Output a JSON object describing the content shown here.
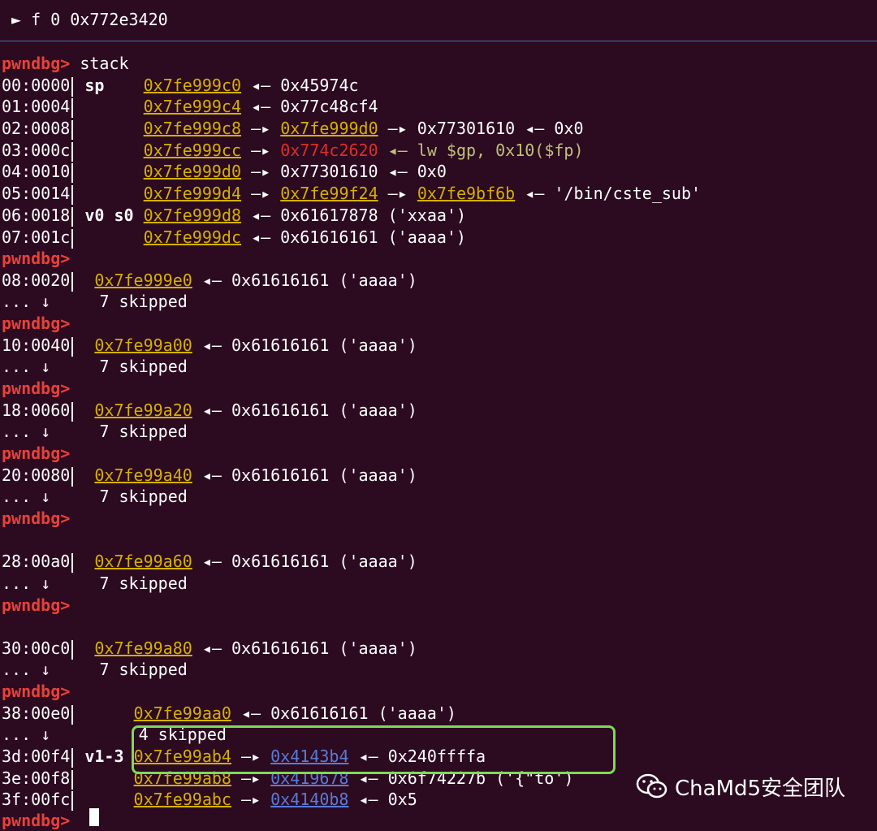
{
  "frame": {
    "marker": "►",
    "text": "f 0 0x772e3420"
  },
  "prompt": "pwndbg>",
  "command": "stack",
  "lines": [
    {
      "idx": "00:0000",
      "reg": "sp",
      "addr": "0x7fe999c0",
      "rest": "◂— 0x45974c"
    },
    {
      "idx": "01:0004",
      "reg": "",
      "addr": "0x7fe999c4",
      "rest": "◂— 0x77c48cf4"
    },
    {
      "idx": "02:0008",
      "reg": "",
      "addr": "0x7fe999c8",
      "arrow": "—▸",
      "addr2": "0x7fe999d0",
      "rest": "—▸ 0x77301610 ◂— 0x0"
    },
    {
      "idx": "03:000c",
      "reg": "",
      "addr": "0x7fe999cc",
      "arrow": "—▸",
      "red": "0x774c2620",
      "rest": "◂— lw $gp, 0x10($fp)"
    },
    {
      "idx": "04:0010",
      "reg": "",
      "addr": "0x7fe999d0",
      "rest": "—▸ 0x77301610 ◂— 0x0"
    },
    {
      "idx": "05:0014",
      "reg": "",
      "addr": "0x7fe999d4",
      "arrow": "—▸",
      "addr2": "0x7fe99f24",
      "arrow2": "—▸",
      "addr3": "0x7fe9bf6b",
      "rest": "◂— '/bin/cste_sub'"
    },
    {
      "idx": "06:0018",
      "reg": "v0 s0",
      "addr": "0x7fe999d8",
      "rest": "◂— 0x61617878 ('xxaa')"
    },
    {
      "idx": "07:001c",
      "reg": "",
      "addr": "0x7fe999dc",
      "rest": "◂— 0x61616161 ('aaaa')"
    }
  ],
  "groups": [
    {
      "idx": "08:0020",
      "addr": "0x7fe999e0",
      "rest": "◂— 0x61616161 ('aaaa')",
      "skip": "7 skipped"
    },
    {
      "idx": "10:0040",
      "addr": "0x7fe99a00",
      "rest": "◂— 0x61616161 ('aaaa')",
      "skip": "7 skipped"
    },
    {
      "idx": "18:0060",
      "addr": "0x7fe99a20",
      "rest": "◂— 0x61616161 ('aaaa')",
      "skip": "7 skipped"
    },
    {
      "idx": "20:0080",
      "addr": "0x7fe99a40",
      "rest": "◂— 0x61616161 ('aaaa')",
      "skip": "7 skipped"
    },
    {
      "idx": "28:00a0",
      "addr": "0x7fe99a60",
      "rest": "◂— 0x61616161 ('aaaa')",
      "skip": "7 skipped"
    },
    {
      "idx": "30:00c0",
      "addr": "0x7fe99a80",
      "rest": "◂— 0x61616161 ('aaaa')",
      "skip": "7 skipped"
    }
  ],
  "tail": {
    "l38": {
      "idx": "38:00e0",
      "addr": "0x7fe99aa0",
      "rest": "◂— 0x61616161 ('aaaa')"
    },
    "skip4": "4 skipped",
    "l3d": {
      "idx": "3d:00f4",
      "reg": "v1-3",
      "addr": "0x7fe99ab4",
      "code": "0x4143b4",
      "rest": "◂— 0x240ffffa"
    },
    "l3e": {
      "idx": "3e:00f8",
      "addr": "0x7fe99ab8",
      "code": "0x419678",
      "rest": "◂— 0x6f74227b ('{\"to')"
    },
    "l3f": {
      "idx": "3f:00fc",
      "addr": "0x7fe99abc",
      "code": "0x4140b8",
      "rest": "◂— 0x5"
    }
  },
  "dots": "... ↓",
  "watermark": "ChaMd5安全团队"
}
